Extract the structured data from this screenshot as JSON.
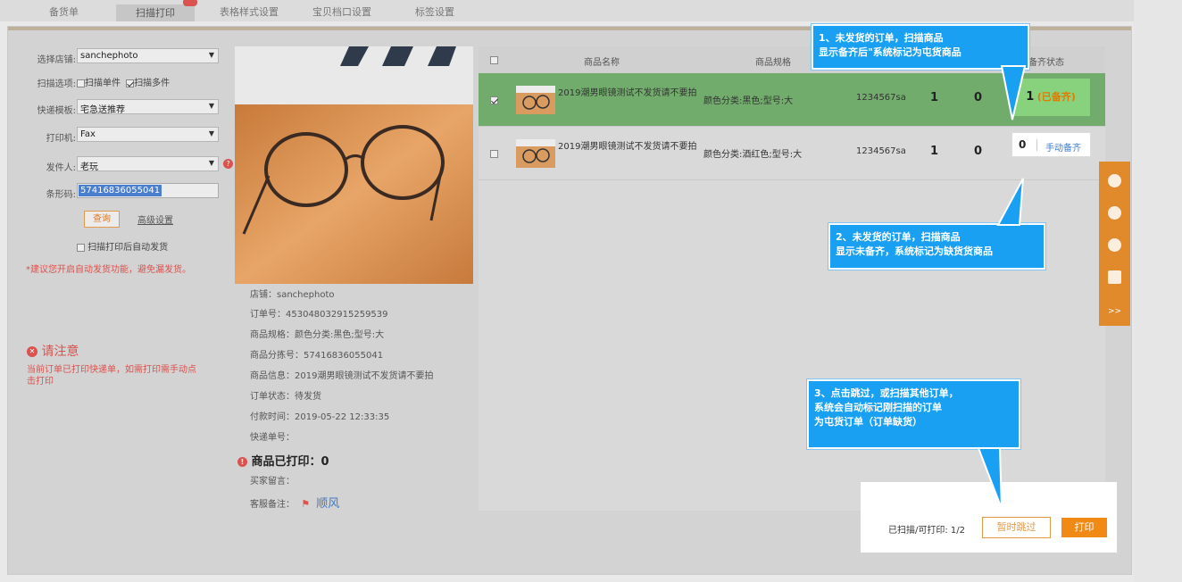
{
  "tabs": [
    {
      "label": "备货单",
      "active": false
    },
    {
      "label": "扫描打印",
      "active": true
    },
    {
      "label": "表格样式设置",
      "active": false
    },
    {
      "label": "宝贝档口设置",
      "active": false
    },
    {
      "label": "标签设置",
      "active": false
    }
  ],
  "form": {
    "store_label": "选择店铺:",
    "store_value": "sanchephoto",
    "scan_label": "扫描选项:",
    "scan_single": "扫描单件",
    "scan_multi": "扫描多件",
    "express_label": "快递模板:",
    "express_value": "宅急送推荐",
    "printer_label": "打印机:",
    "printer_value": "Fax",
    "sender_label": "发件人:",
    "sender_value": "老玩",
    "barcode_label": "条形码:",
    "barcode_value": "57416836055041",
    "query_button": "查询",
    "advanced_link": "高级设置",
    "auto_ship": "扫描打印后自动发货",
    "tip": "*建议您开启自动发货功能，避免漏发货。"
  },
  "notice": {
    "title": "请注意",
    "text_line1": "当前订单已打印快递单，如需打印需手动点",
    "text_line2": "击打印"
  },
  "order_info": {
    "store": "店铺：sanchephoto",
    "order_no": "订单号：453048032915259539",
    "spec": "商品规格：颜色分类:黑色;型号:大",
    "sort_code": "商品分拣号：57416836055041",
    "product": "商品信息：2019潮男眼镜测试不发货请不要拍",
    "status": "订单状态：待发货",
    "paid_time": "付款时间：2019-05-22 12:33:35",
    "tracking": "快递单号：",
    "printed": "商品已打印：0",
    "buyer_note": "买家留言：",
    "service_note_label": "客服备注：",
    "service_note_value": "顺风"
  },
  "table": {
    "headers": {
      "name": "商品名称",
      "spec": "商品规格",
      "status": "备齐状态"
    },
    "rows": [
      {
        "checked": true,
        "name": "2019潮男眼镜测试不发货请不要拍",
        "spec": "颜色分类:黑色;型号:大",
        "code": "1234567sa",
        "qty": "1",
        "scanned": "0",
        "ready_count": "1",
        "ready_text": "(已备齐)"
      },
      {
        "checked": false,
        "name": "2019潮男眼镜测试不发货请不要拍",
        "spec": "颜色分类:酒红色;型号:大",
        "code": "1234567sa",
        "qty": "1",
        "scanned": "0",
        "ready_count": "0",
        "ready_text": "手动备齐"
      }
    ]
  },
  "bottom": {
    "scanned_text": "已扫描/可打印: 1/2",
    "skip_button": "暂时跳过",
    "print_button": "打印"
  },
  "callouts": {
    "c1_line1": "1、未发货的订单，扫描商品",
    "c1_line2": "显示备齐后\"系统标记为屯货商品",
    "c2_line1": "2、未发货的订单，扫描商品",
    "c2_line2": "显示未备齐，系统标记为缺货货商品",
    "c3_line1": "3、点击跳过，或扫描其他订单，",
    "c3_line2": "系统会自动标记刚扫描的订单",
    "c3_line3": "为屯货订单（订单缺货）"
  },
  "sidebar_icons": [
    "chat-icon",
    "bell-icon",
    "help-icon",
    "edit-icon"
  ],
  "colors": {
    "accent": "#f08a14",
    "callout": "#1aa0f2",
    "ready": "#88d27e",
    "row_selected": "#72ac6d",
    "warn": "#d9534f"
  }
}
